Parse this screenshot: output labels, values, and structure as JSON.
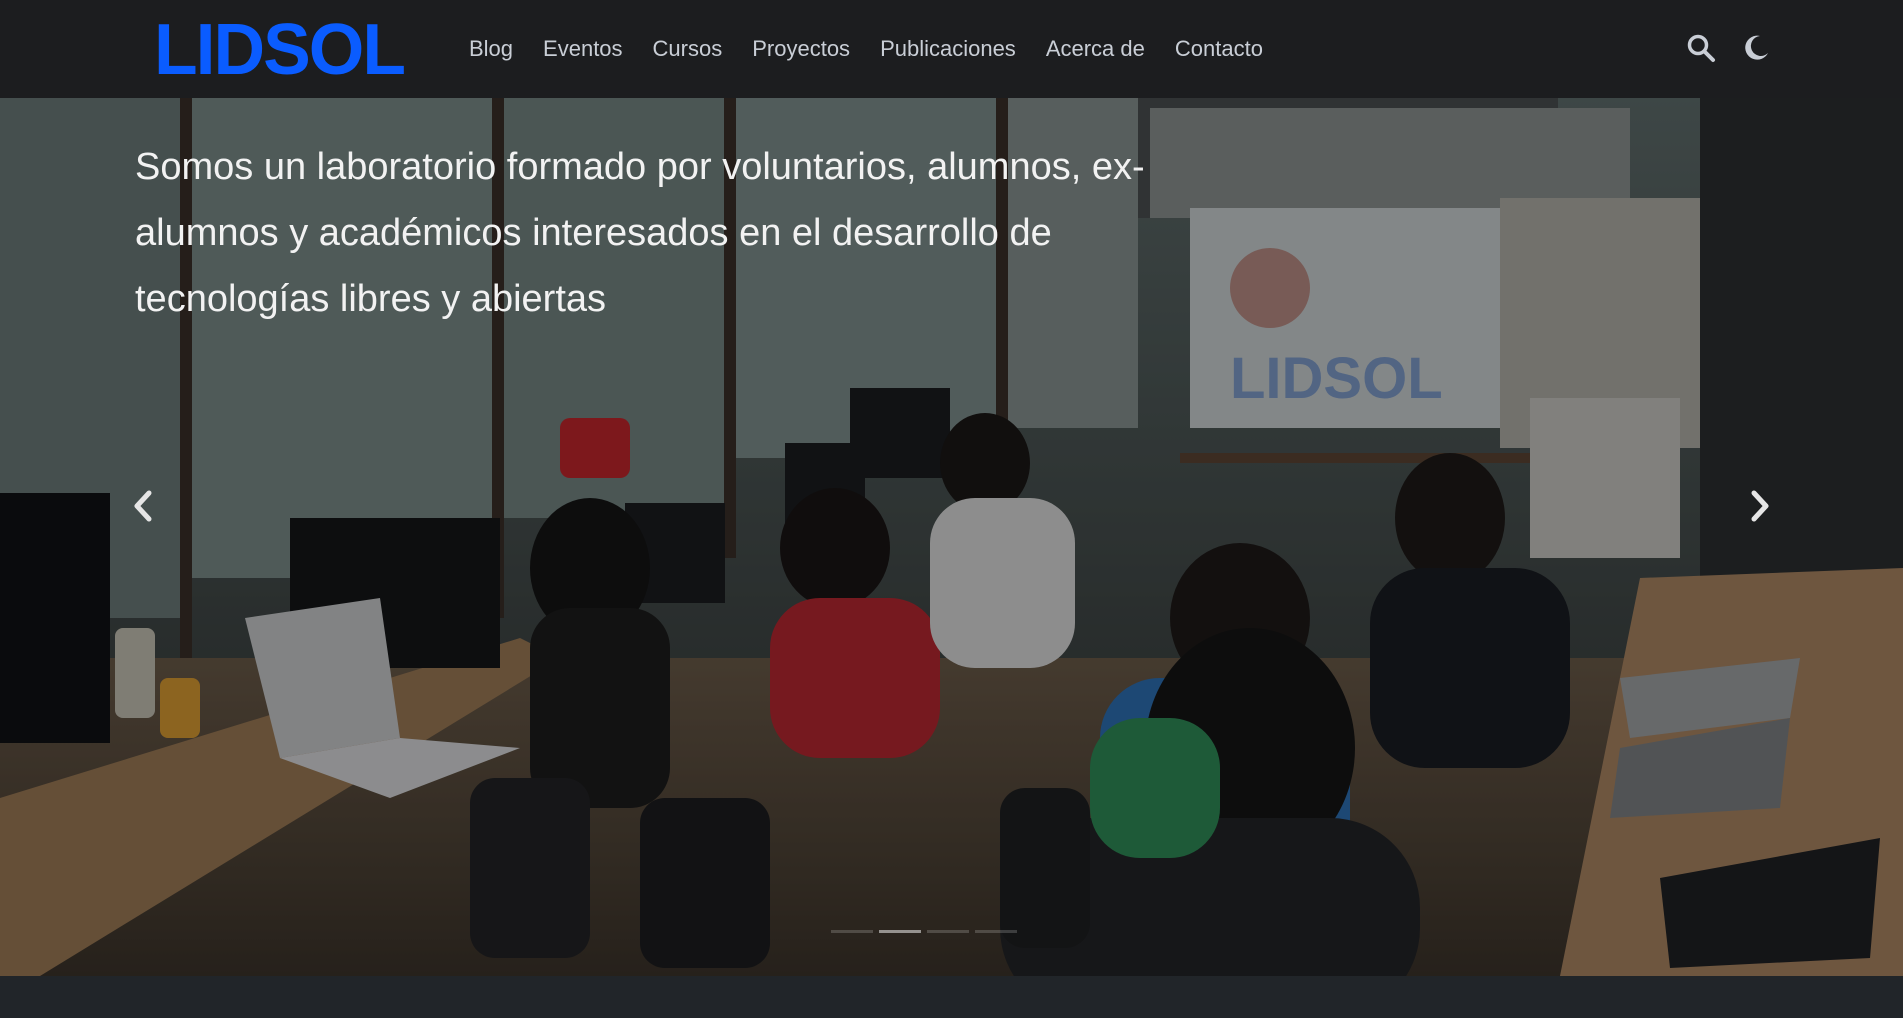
{
  "brand": {
    "logo_text": "LIDSOL",
    "logo_color": "#0a5cff"
  },
  "nav": {
    "items": [
      {
        "label": "Blog"
      },
      {
        "label": "Eventos"
      },
      {
        "label": "Cursos"
      },
      {
        "label": "Proyectos"
      },
      {
        "label": "Publicaciones"
      },
      {
        "label": "Acerca de"
      },
      {
        "label": "Contacto"
      }
    ],
    "icons": [
      "search-icon",
      "moon-icon"
    ]
  },
  "hero": {
    "caption": "Somos un laboratorio formado por voluntarios, alumnos, ex-alumnos y académicos interesados en el desarrollo de tecnologías libres y abiertas",
    "prev_icon": "chevron-left-icon",
    "next_icon": "chevron-right-icon",
    "slides_count": 4,
    "active_slide": 2
  },
  "colors": {
    "navbar_bg": "#1c1d1f",
    "nav_text": "#c9ced6",
    "page_bg": "#212529",
    "accent": "#0a5cff"
  }
}
